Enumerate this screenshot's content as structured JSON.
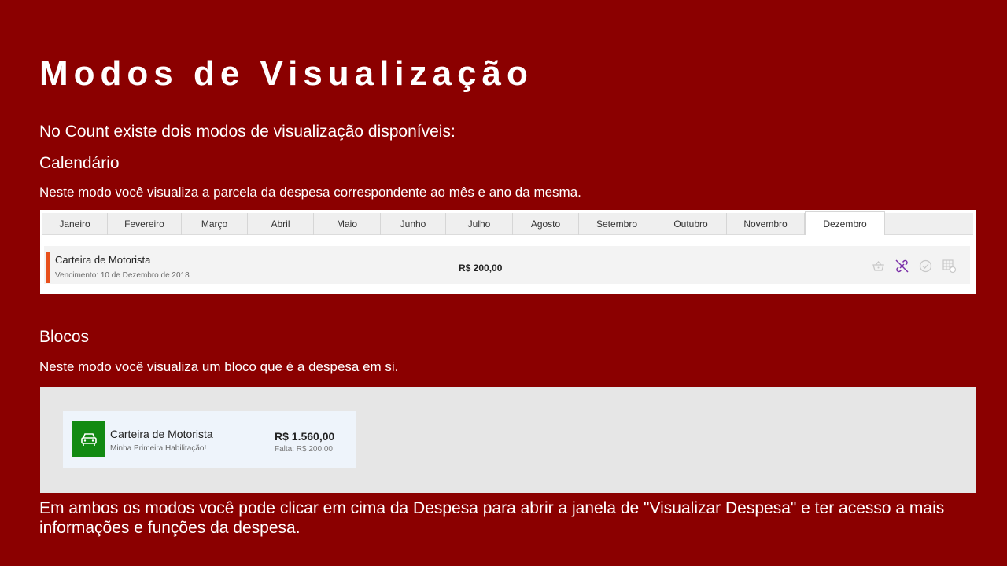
{
  "slide": {
    "title": "Modos de Visualização",
    "intro": "No Count existe dois modos de visualização disponíveis:",
    "footer": "Em ambos os modos você pode clicar em cima da Despesa para abrir a janela de \"Visualizar Despesa\" e ter acesso a mais informações e funções da despesa."
  },
  "calendar": {
    "heading": "Calendário",
    "description": "Neste modo você visualiza a parcela da despesa correspondente ao mês e ano da mesma.",
    "months": [
      "Janeiro",
      "Fevereiro",
      "Março",
      "Abril",
      "Maio",
      "Junho",
      "Julho",
      "Agosto",
      "Setembro",
      "Outubro",
      "Novembro",
      "Dezembro"
    ],
    "active_month": "Dezembro",
    "expense": {
      "name": "Carteira de Motorista",
      "due": "Vencimento: 10 de Dezembro de 2018",
      "value": "R$ 200,00",
      "accent_color": "#e8501c",
      "icons": [
        "basket-icon",
        "unlink-icon",
        "check-circle-icon",
        "calendar-grid-icon"
      ]
    }
  },
  "blocks": {
    "heading": "Blocos",
    "description": "Neste modo você visualiza um bloco que é a despesa em si.",
    "card": {
      "name": "Carteira de Motorista",
      "subtitle": "Minha Primeira Habilitação!",
      "value": "R$ 1.560,00",
      "missing": "Falta: R$ 200,00",
      "icon": "car-icon",
      "icon_bg": "#128a12"
    }
  }
}
